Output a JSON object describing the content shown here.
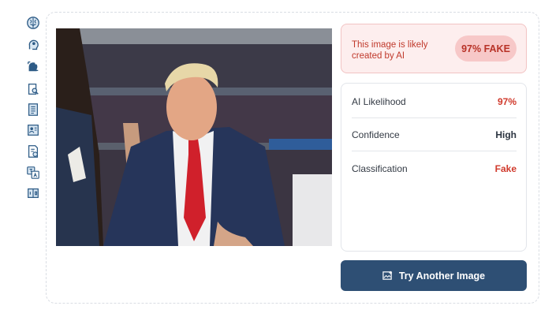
{
  "sidebar": {
    "icons": [
      {
        "name": "brain-icon"
      },
      {
        "name": "head-idea-icon"
      },
      {
        "name": "face-scan-icon"
      },
      {
        "name": "document-search-icon"
      },
      {
        "name": "document-list-icon"
      },
      {
        "name": "user-document-icon"
      },
      {
        "name": "document-edit-icon"
      },
      {
        "name": "translate-icon"
      },
      {
        "name": "compare-icon"
      }
    ]
  },
  "result": {
    "message": "This image is likely created by AI",
    "badge": "97% FAKE",
    "accent_color": "#c0392b"
  },
  "metrics": [
    {
      "label": "AI Likelihood",
      "value": "97%",
      "color": "#d0392b"
    },
    {
      "label": "Confidence",
      "value": "High",
      "color": "#2b3440"
    },
    {
      "label": "Classification",
      "value": "Fake",
      "color": "#d0392b"
    }
  ],
  "actions": {
    "try_another": "Try Another Image",
    "button_color": "#2e4f74"
  }
}
